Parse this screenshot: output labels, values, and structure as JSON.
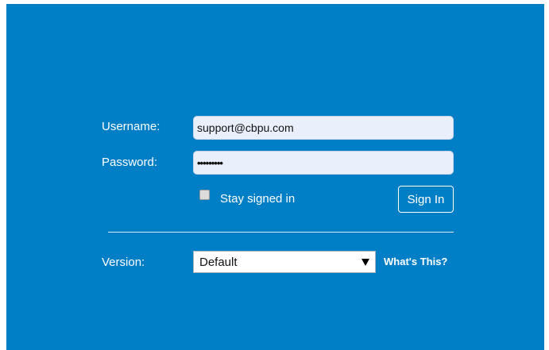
{
  "login": {
    "username_label": "Username:",
    "username_value": "support@cbpu.com",
    "password_label": "Password:",
    "password_value": "•••••••••",
    "stay_signed_in_label": "Stay signed in",
    "stay_signed_in_checked": false,
    "sign_in_label": "Sign In"
  },
  "version": {
    "label": "Version:",
    "selected": "Default",
    "help_link": "What's This?"
  },
  "colors": {
    "panel_bg": "#007ec6",
    "field_bg": "#e9f0fc",
    "text_light": "#ffffff"
  }
}
